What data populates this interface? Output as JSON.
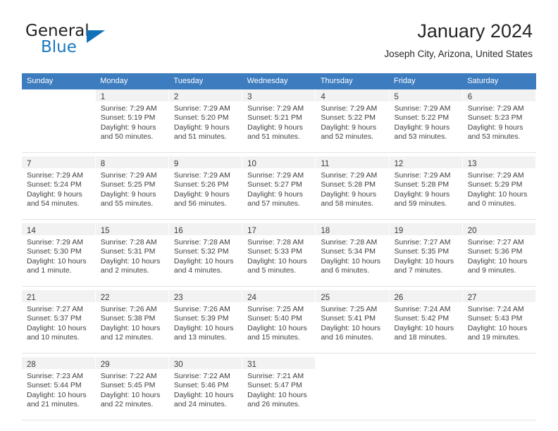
{
  "brand": {
    "name_part1": "General",
    "name_part2": "Blue",
    "accent_color": "#1070b8",
    "logo_icon": "triangle-flag-icon"
  },
  "header": {
    "title": "January 2024",
    "location": "Joseph City, Arizona, United States"
  },
  "calendar": {
    "header_bg": "#3d7cbf",
    "daynum_bg": "#f2f2f2",
    "weekday_headers": [
      "Sunday",
      "Monday",
      "Tuesday",
      "Wednesday",
      "Thursday",
      "Friday",
      "Saturday"
    ],
    "weeks": [
      [
        {
          "day": "",
          "lines": []
        },
        {
          "day": "1",
          "lines": [
            "Sunrise: 7:29 AM",
            "Sunset: 5:19 PM",
            "Daylight: 9 hours",
            "and 50 minutes."
          ]
        },
        {
          "day": "2",
          "lines": [
            "Sunrise: 7:29 AM",
            "Sunset: 5:20 PM",
            "Daylight: 9 hours",
            "and 51 minutes."
          ]
        },
        {
          "day": "3",
          "lines": [
            "Sunrise: 7:29 AM",
            "Sunset: 5:21 PM",
            "Daylight: 9 hours",
            "and 51 minutes."
          ]
        },
        {
          "day": "4",
          "lines": [
            "Sunrise: 7:29 AM",
            "Sunset: 5:22 PM",
            "Daylight: 9 hours",
            "and 52 minutes."
          ]
        },
        {
          "day": "5",
          "lines": [
            "Sunrise: 7:29 AM",
            "Sunset: 5:22 PM",
            "Daylight: 9 hours",
            "and 53 minutes."
          ]
        },
        {
          "day": "6",
          "lines": [
            "Sunrise: 7:29 AM",
            "Sunset: 5:23 PM",
            "Daylight: 9 hours",
            "and 53 minutes."
          ]
        }
      ],
      [
        {
          "day": "7",
          "lines": [
            "Sunrise: 7:29 AM",
            "Sunset: 5:24 PM",
            "Daylight: 9 hours",
            "and 54 minutes."
          ]
        },
        {
          "day": "8",
          "lines": [
            "Sunrise: 7:29 AM",
            "Sunset: 5:25 PM",
            "Daylight: 9 hours",
            "and 55 minutes."
          ]
        },
        {
          "day": "9",
          "lines": [
            "Sunrise: 7:29 AM",
            "Sunset: 5:26 PM",
            "Daylight: 9 hours",
            "and 56 minutes."
          ]
        },
        {
          "day": "10",
          "lines": [
            "Sunrise: 7:29 AM",
            "Sunset: 5:27 PM",
            "Daylight: 9 hours",
            "and 57 minutes."
          ]
        },
        {
          "day": "11",
          "lines": [
            "Sunrise: 7:29 AM",
            "Sunset: 5:28 PM",
            "Daylight: 9 hours",
            "and 58 minutes."
          ]
        },
        {
          "day": "12",
          "lines": [
            "Sunrise: 7:29 AM",
            "Sunset: 5:28 PM",
            "Daylight: 9 hours",
            "and 59 minutes."
          ]
        },
        {
          "day": "13",
          "lines": [
            "Sunrise: 7:29 AM",
            "Sunset: 5:29 PM",
            "Daylight: 10 hours",
            "and 0 minutes."
          ]
        }
      ],
      [
        {
          "day": "14",
          "lines": [
            "Sunrise: 7:29 AM",
            "Sunset: 5:30 PM",
            "Daylight: 10 hours",
            "and 1 minute."
          ]
        },
        {
          "day": "15",
          "lines": [
            "Sunrise: 7:28 AM",
            "Sunset: 5:31 PM",
            "Daylight: 10 hours",
            "and 2 minutes."
          ]
        },
        {
          "day": "16",
          "lines": [
            "Sunrise: 7:28 AM",
            "Sunset: 5:32 PM",
            "Daylight: 10 hours",
            "and 4 minutes."
          ]
        },
        {
          "day": "17",
          "lines": [
            "Sunrise: 7:28 AM",
            "Sunset: 5:33 PM",
            "Daylight: 10 hours",
            "and 5 minutes."
          ]
        },
        {
          "day": "18",
          "lines": [
            "Sunrise: 7:28 AM",
            "Sunset: 5:34 PM",
            "Daylight: 10 hours",
            "and 6 minutes."
          ]
        },
        {
          "day": "19",
          "lines": [
            "Sunrise: 7:27 AM",
            "Sunset: 5:35 PM",
            "Daylight: 10 hours",
            "and 7 minutes."
          ]
        },
        {
          "day": "20",
          "lines": [
            "Sunrise: 7:27 AM",
            "Sunset: 5:36 PM",
            "Daylight: 10 hours",
            "and 9 minutes."
          ]
        }
      ],
      [
        {
          "day": "21",
          "lines": [
            "Sunrise: 7:27 AM",
            "Sunset: 5:37 PM",
            "Daylight: 10 hours",
            "and 10 minutes."
          ]
        },
        {
          "day": "22",
          "lines": [
            "Sunrise: 7:26 AM",
            "Sunset: 5:38 PM",
            "Daylight: 10 hours",
            "and 12 minutes."
          ]
        },
        {
          "day": "23",
          "lines": [
            "Sunrise: 7:26 AM",
            "Sunset: 5:39 PM",
            "Daylight: 10 hours",
            "and 13 minutes."
          ]
        },
        {
          "day": "24",
          "lines": [
            "Sunrise: 7:25 AM",
            "Sunset: 5:40 PM",
            "Daylight: 10 hours",
            "and 15 minutes."
          ]
        },
        {
          "day": "25",
          "lines": [
            "Sunrise: 7:25 AM",
            "Sunset: 5:41 PM",
            "Daylight: 10 hours",
            "and 16 minutes."
          ]
        },
        {
          "day": "26",
          "lines": [
            "Sunrise: 7:24 AM",
            "Sunset: 5:42 PM",
            "Daylight: 10 hours",
            "and 18 minutes."
          ]
        },
        {
          "day": "27",
          "lines": [
            "Sunrise: 7:24 AM",
            "Sunset: 5:43 PM",
            "Daylight: 10 hours",
            "and 19 minutes."
          ]
        }
      ],
      [
        {
          "day": "28",
          "lines": [
            "Sunrise: 7:23 AM",
            "Sunset: 5:44 PM",
            "Daylight: 10 hours",
            "and 21 minutes."
          ]
        },
        {
          "day": "29",
          "lines": [
            "Sunrise: 7:22 AM",
            "Sunset: 5:45 PM",
            "Daylight: 10 hours",
            "and 22 minutes."
          ]
        },
        {
          "day": "30",
          "lines": [
            "Sunrise: 7:22 AM",
            "Sunset: 5:46 PM",
            "Daylight: 10 hours",
            "and 24 minutes."
          ]
        },
        {
          "day": "31",
          "lines": [
            "Sunrise: 7:21 AM",
            "Sunset: 5:47 PM",
            "Daylight: 10 hours",
            "and 26 minutes."
          ]
        },
        {
          "day": "",
          "lines": []
        },
        {
          "day": "",
          "lines": []
        },
        {
          "day": "",
          "lines": []
        }
      ]
    ]
  }
}
